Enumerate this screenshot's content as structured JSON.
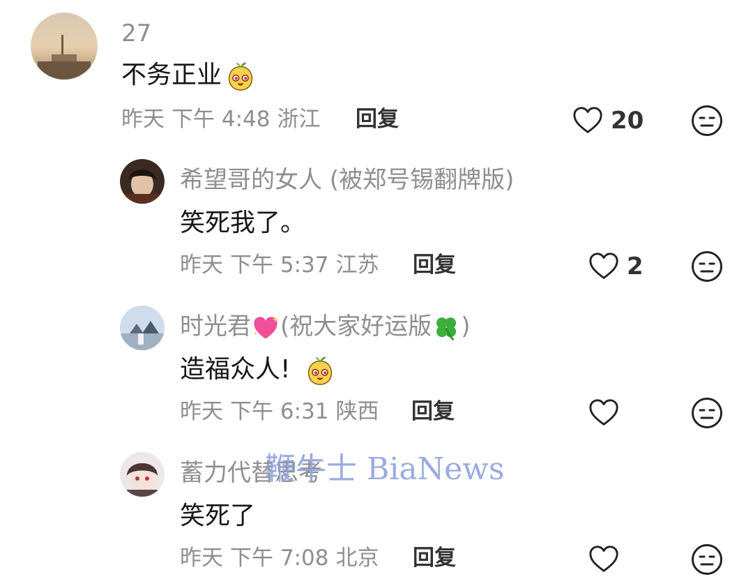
{
  "comments": [
    {
      "username": "27",
      "text": "不务正业",
      "date": "昨天",
      "time": "下午 4:48",
      "location": "浙江",
      "reply_label": "回复",
      "likes": "20"
    },
    {
      "username": "希望哥的女人 (被郑号锡翻牌版)",
      "text": "笑死我了。",
      "date": "昨天",
      "time": "下午 5:37",
      "location": "江苏",
      "reply_label": "回复",
      "likes": "2"
    },
    {
      "username_main": "时光君",
      "username_suffix_open": "(祝大家好运版",
      "username_suffix_close": ")",
      "text": "造福众人!",
      "date": "昨天",
      "time": "下午 6:31",
      "location": "陕西",
      "reply_label": "回复",
      "likes": ""
    },
    {
      "username": "蓄力代替思考",
      "text": "笑死了",
      "date": "昨天",
      "time": "下午 7:08",
      "location": "北京",
      "reply_label": "回复",
      "likes": ""
    }
  ],
  "watermark": "鞭牛士 BiaNews",
  "icons": {
    "like": "heart-outline-icon",
    "dislike": "meh-face-icon",
    "emoji_bean": "bean-sprout-emoji",
    "emoji_heart": "sparkling-heart-emoji",
    "emoji_clover": "four-leaf-clover-emoji"
  },
  "colors": {
    "secondary_text": "#8e8e8e",
    "primary_text": "#161616",
    "icon": "#222222",
    "watermark": "#8ea2dc"
  }
}
